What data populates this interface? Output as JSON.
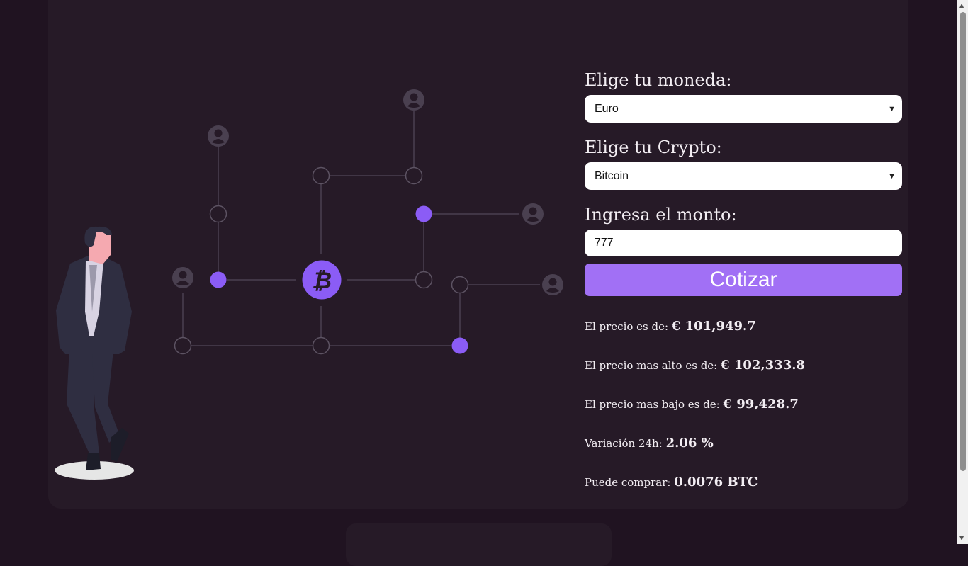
{
  "form": {
    "currency_label": "Elige tu moneda:",
    "currency_value": "Euro",
    "crypto_label": "Elige tu Crypto:",
    "crypto_value": "Bitcoin",
    "amount_label": "Ingresa el monto:",
    "amount_value": "777",
    "submit_label": "Cotizar"
  },
  "results": {
    "price_label": "El precio es de:",
    "price_value": "€ 101,949.7",
    "high_label": "El precio mas alto es de:",
    "high_value": "€ 102,333.8",
    "low_label": "El precio mas bajo es de:",
    "low_value": "€ 99,428.7",
    "change_label": "Variación 24h:",
    "change_value": "2.06 %",
    "buy_label": "Puede comprar:",
    "buy_value": "0.0076 BTC"
  },
  "icons": {
    "bitcoin": "bitcoin-icon",
    "user": "user-icon",
    "person": "businessman-illustration"
  },
  "colors": {
    "background": "#201321",
    "card": "#261a27",
    "accent": "#a170f5",
    "node_purple": "#8b5cf6",
    "line": "#4a4050"
  }
}
